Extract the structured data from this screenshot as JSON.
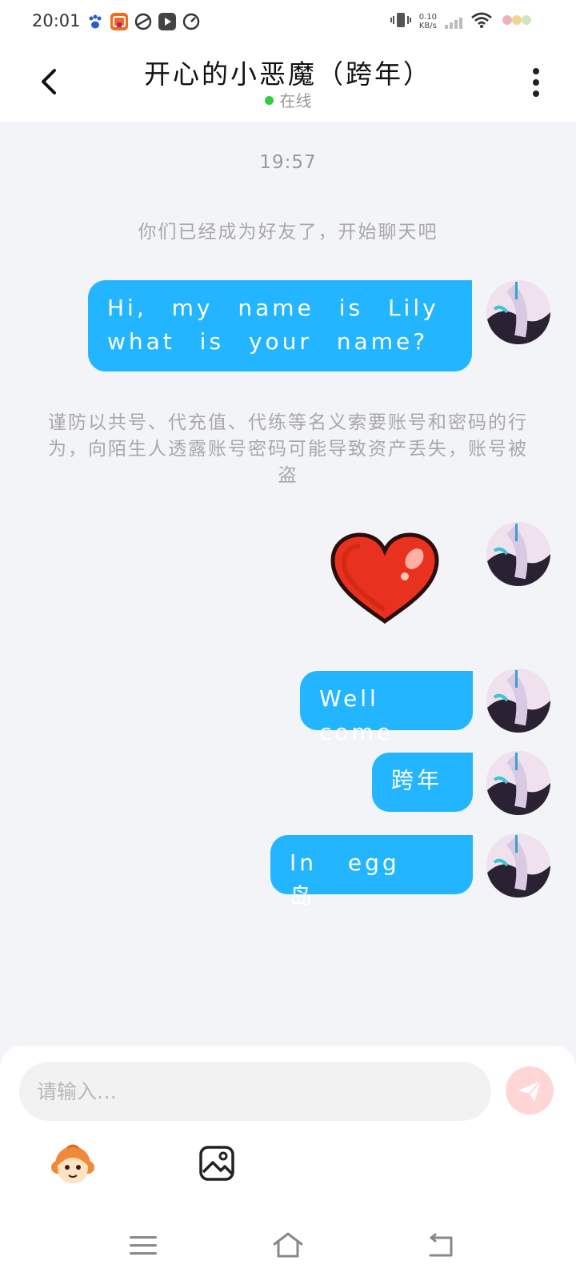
{
  "status_bar": {
    "time": "20:01",
    "net_speed_value": "0.10",
    "net_speed_unit": "KB/s",
    "app_icons": [
      "baidu-paw-icon",
      "video-app-icon",
      "browser-app-icon",
      "player-app-icon",
      "speed-app-icon"
    ]
  },
  "header": {
    "title": "开心的小恶魔（跨年）",
    "presence": "在线",
    "presence_color": "#2ecc40"
  },
  "chat": {
    "time": "19:57",
    "system_friend_notice": "你们已经成为好友了，开始聊天吧",
    "system_warning": "谨防以共号、代充值、代练等名义索要账号和密码的行为，向陌生人透露账号密码可能导致资产丢失，账号被盗",
    "messages": [
      {
        "type": "text",
        "text": "Hi, my name is Lily what is your name?",
        "sender": "self"
      },
      {
        "type": "sticker",
        "sticker": "heart-icon",
        "sender": "self"
      },
      {
        "type": "text",
        "text": "Well come",
        "sender": "self"
      },
      {
        "type": "text",
        "text": "跨年",
        "sender": "self"
      },
      {
        "type": "text",
        "text": "In egg 岛",
        "sender": "self"
      }
    ],
    "bubble_color": "#23b5ff"
  },
  "input": {
    "placeholder": "请输入…",
    "value": ""
  },
  "toolbar": {
    "emoji_icon": "monkey-emoji-icon",
    "image_icon": "image-icon",
    "send_icon": "send-icon"
  },
  "nav_bar": {
    "icons": [
      "menu-icon",
      "home-icon",
      "back-nav-icon"
    ]
  }
}
